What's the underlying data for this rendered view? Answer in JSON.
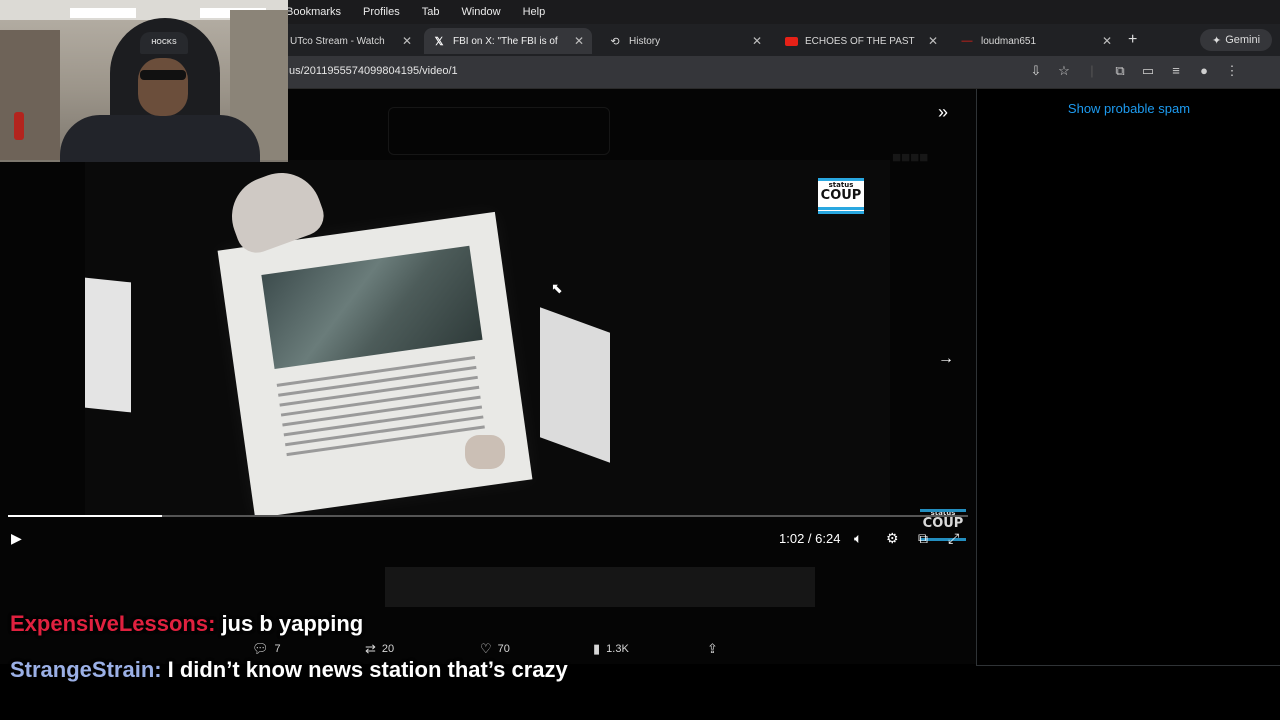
{
  "menubar": {
    "items": [
      "Bookmarks",
      "Profiles",
      "Tab",
      "Window",
      "Help"
    ]
  },
  "tabs": [
    {
      "title": "UTco Stream - Watch",
      "icon": "stream-icon",
      "active": false
    },
    {
      "title": "FBI on X: \"The FBI is of",
      "icon": "x-logo-icon",
      "active": true
    },
    {
      "title": "History",
      "icon": "history-icon",
      "active": false
    },
    {
      "title": "ECHOES OF THE PAST",
      "icon": "youtube-icon",
      "active": false
    },
    {
      "title": "loudman651",
      "icon": "dash-icon",
      "active": false
    }
  ],
  "gemini": {
    "label": "Gemini"
  },
  "address": {
    "url": "us/2011955574099804195/video/1"
  },
  "sidepanel": {
    "spam_link": "Show probable spam"
  },
  "video": {
    "current_time": "1:02",
    "duration": "6:24",
    "time_display": "1:02 / 6:24",
    "progress": 0.16,
    "logo": {
      "line1": "status",
      "line2": "COUP"
    },
    "logo_bottom": {
      "line1": "status",
      "line2": "COUP"
    },
    "webcam_beanie_text": "HOCKS"
  },
  "tweet_actions": {
    "replies": "7",
    "reposts": "20",
    "likes": "70",
    "views": "1.3K"
  },
  "chat": [
    {
      "user": "ExpensiveLessons:",
      "user_color": "#e0213f",
      "message": "jus b yapping"
    },
    {
      "user": "StrangeStrain:",
      "user_color": "#9bb0e6",
      "message": "I didn’t know news station that’s crazy"
    }
  ],
  "colors": {
    "accent": "#1d9bf0",
    "logo_blue": "#29a7e0"
  }
}
